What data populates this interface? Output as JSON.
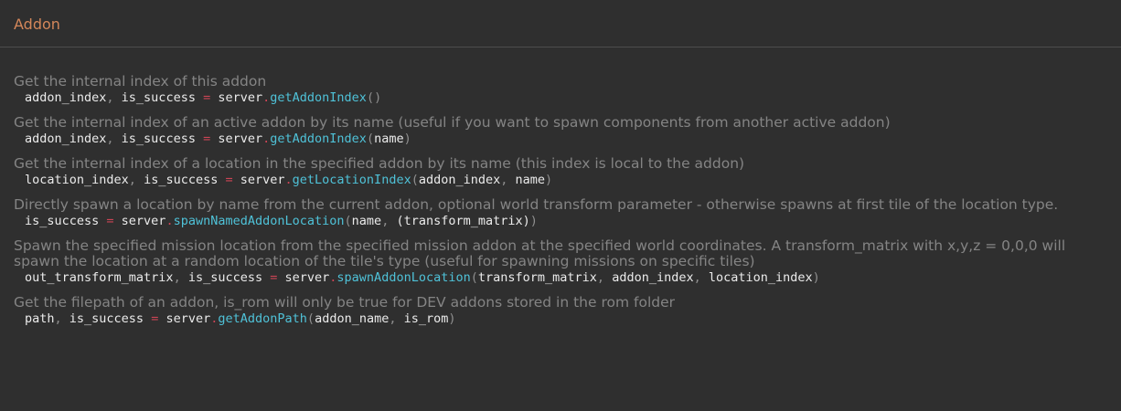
{
  "section": {
    "title": "Addon"
  },
  "entries": [
    {
      "description": "Get the internal index of this addon",
      "code": {
        "returns": [
          "addon_index",
          "is_success"
        ],
        "object": "server",
        "function": "getAddonIndex",
        "args": []
      }
    },
    {
      "description": "Get the internal index of an active addon by its name (useful if you want to spawn components from another active addon)",
      "code": {
        "returns": [
          "addon_index",
          "is_success"
        ],
        "object": "server",
        "function": "getAddonIndex",
        "args": [
          "name"
        ]
      }
    },
    {
      "description": "Get the internal index of a location in the specified addon by its name (this index is local to the addon)",
      "code": {
        "returns": [
          "location_index",
          "is_success"
        ],
        "object": "server",
        "function": "getLocationIndex",
        "args": [
          "addon_index",
          "name"
        ]
      }
    },
    {
      "description": "Directly spawn a location by name from the current addon, optional world transform parameter - otherwise spawns at first tile of the location type.",
      "code": {
        "returns": [
          "is_success"
        ],
        "object": "server",
        "function": "spawnNamedAddonLocation",
        "args": [
          "name",
          "(transform_matrix)"
        ]
      }
    },
    {
      "description": "Spawn the specified mission location from the specified mission addon at  the specified world coordinates. A transform_matrix with x,y,z = 0,0,0 will spawn the location at a random location of the tile's type (useful for spawning missions on specific tiles)",
      "code": {
        "returns": [
          "out_transform_matrix",
          "is_success"
        ],
        "object": "server",
        "function": "spawnAddonLocation",
        "args": [
          "transform_matrix",
          "addon_index",
          "location_index"
        ]
      }
    },
    {
      "description": "Get the filepath of an addon, is_rom will only be true for DEV addons stored in the rom folder",
      "code": {
        "returns": [
          "path",
          "is_success"
        ],
        "object": "server",
        "function": "getAddonPath",
        "args": [
          "addon_name",
          "is_rom"
        ]
      }
    }
  ],
  "colors": {
    "background": "#2f2f2f",
    "title": "#d4875a",
    "description": "#848484",
    "code_text": "#ebebeb",
    "operator": "#cc4455",
    "function": "#4fc2d8"
  }
}
